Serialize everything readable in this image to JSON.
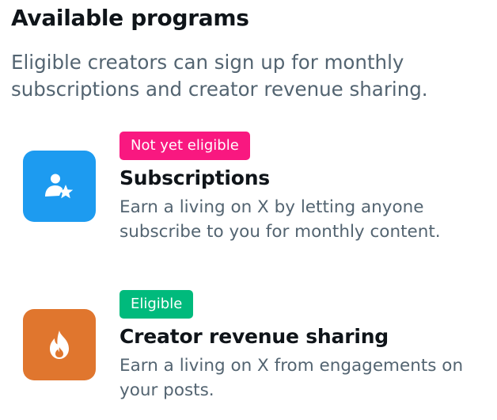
{
  "header": {
    "title": "Available programs",
    "subtitle": "Eligible creators can sign up for monthly subscriptions and creator revenue sharing."
  },
  "programs": [
    {
      "name": "Subscriptions",
      "status": "Not yet eligible",
      "status_color": "#f91880",
      "description": "Earn a living on X by letting anyone subscribe to you for monthly content.",
      "icon": "person-star-icon",
      "icon_color": "#1d9bf0"
    },
    {
      "name": "Creator revenue sharing",
      "status": "Eligible",
      "status_color": "#00ba7c",
      "description": "Earn a living on X from engagements on your posts.",
      "icon": "flame-icon",
      "icon_color": "#e0762e"
    }
  ]
}
